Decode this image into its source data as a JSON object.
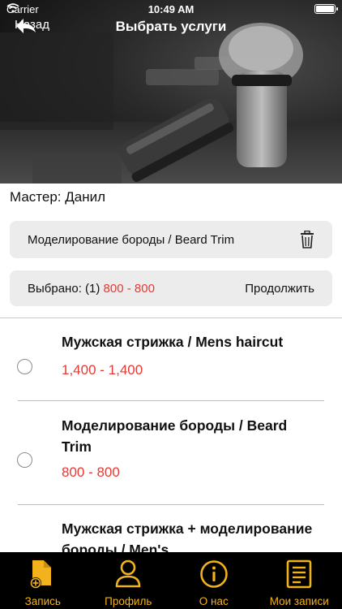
{
  "status_bar": {
    "carrier": "Carrier",
    "time": "10:49 AM"
  },
  "nav": {
    "back_label": "Назад",
    "title": "Выбрать услуги"
  },
  "master_label": "Мастер: Данил",
  "selected_service": {
    "name": "Моделирование бороды  / Beard Trim"
  },
  "summary": {
    "selected_prefix": "Выбрано: (1)",
    "selected_price": "800 - 800",
    "continue_label": "Продолжить"
  },
  "services": [
    {
      "name": "Мужская стрижка / Mens haircut",
      "price": "1,400 - 1,400",
      "selected": false
    },
    {
      "name": "Моделирование бороды  / Beard Trim",
      "price": "800 - 800",
      "selected": false
    },
    {
      "name": "Мужская стрижка + моделирование бороды / Men's",
      "price": "",
      "selected": false
    }
  ],
  "tabs": [
    {
      "label": "Запись",
      "icon": "document-add-icon"
    },
    {
      "label": "Профиль",
      "icon": "user-icon"
    },
    {
      "label": "О нас",
      "icon": "info-icon"
    },
    {
      "label": "Мои записи",
      "icon": "list-icon"
    }
  ],
  "colors": {
    "accent": "#f2b21b",
    "price": "#e53935",
    "tabbar_bg": "#000000"
  }
}
